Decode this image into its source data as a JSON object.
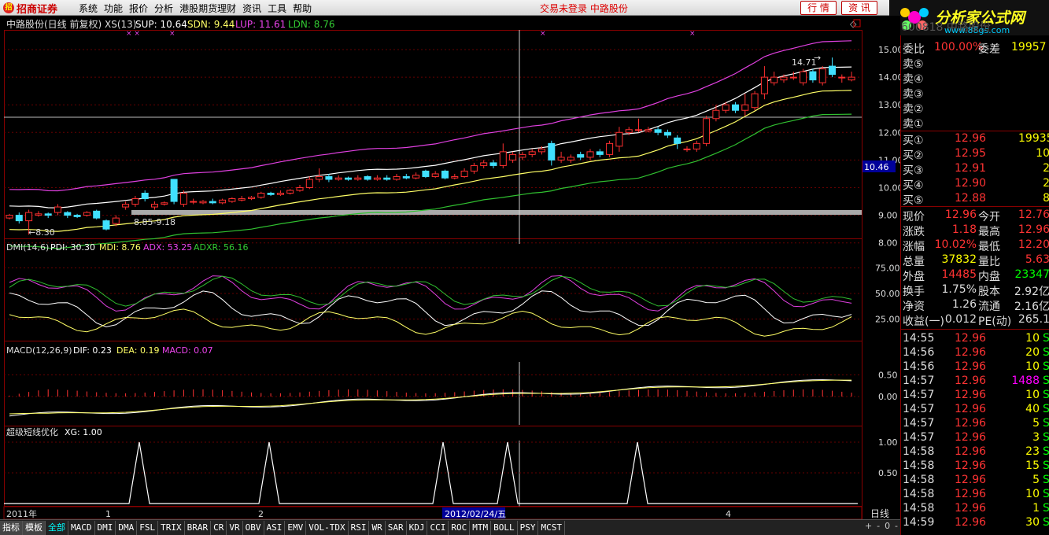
{
  "menubar": {
    "logo": "招商证券",
    "menus": [
      "系统",
      "功能",
      "报价",
      "分析",
      "港股期货理财",
      "资讯",
      "工具",
      "帮助"
    ],
    "login_status": "交易未登录 中路股份",
    "btn_quote": "行 情",
    "btn_news": "资 讯",
    "brand": "分析家公式网",
    "brand_url": "www.88gs.com"
  },
  "main_chart": {
    "title": "中路股份(日线 前复权) XS(13)",
    "sup_label": "SUP: 10.64",
    "sdn_label": "SDN: 9.44",
    "lup_label": "LUP: 11.61",
    "ldn_label": "LDN: 8.76",
    "price_ticks": [
      "15.00",
      "14.00",
      "13.00",
      "12.00",
      "11.00",
      "10.00",
      "9.00",
      "8.00"
    ],
    "current_price_tag": "10.46",
    "annot_low": "←8.30",
    "annot_range": "8.85-9.18",
    "annot_high": "14.71",
    "colors": {
      "up": "#ff3030",
      "down": "#40e0ff",
      "sup": "#ffffff",
      "sdn": "#ffff66",
      "lup": "#e040e0",
      "ldn": "#30c030"
    }
  },
  "dmi_panel": {
    "title": "DMI(14,6)",
    "pdi": "PDI: 30.30",
    "mdi": "MDI: 8.76",
    "adx": "ADX: 53.25",
    "adxr": "ADXR: 56.16",
    "ticks": [
      "75.00",
      "50.00",
      "25.00"
    ]
  },
  "macd_panel": {
    "title": "MACD(12,26,9)",
    "dif": "DIF: 0.23",
    "dea": "DEA: 0.19",
    "macd": "MACD: 0.07",
    "ticks": [
      "0.50",
      "0.00"
    ]
  },
  "xg_panel": {
    "title": "超级短线优化",
    "xg": "XG: 1.00",
    "ticks": [
      "1.00",
      "0.50"
    ]
  },
  "time_axis": {
    "year": "2011年",
    "m1": "1",
    "m2": "2",
    "cursor_date": "2012/02/24/五",
    "m4": "4",
    "period": "日线"
  },
  "bottom_tabs": [
    "指标",
    "模板",
    "全部",
    "MACD",
    "DMI",
    "DMA",
    "FSL",
    "TRIX",
    "BRAR",
    "CR",
    "VR",
    "OBV",
    "ASI",
    "EMV",
    "VOL-TDX",
    "RSI",
    "WR",
    "SAR",
    "KDJ",
    "CCI",
    "ROC",
    "MTM",
    "BOLL",
    "PSY",
    "MCST"
  ],
  "quote_panel": {
    "code_header": "600818 中路股份",
    "webi": "委比",
    "webi_val": "100.00%",
    "wecha": "委差",
    "wecha_val": "19957",
    "sells": [
      {
        "label": "卖⑤",
        "price": "",
        "vol": ""
      },
      {
        "label": "卖④",
        "price": "",
        "vol": ""
      },
      {
        "label": "卖③",
        "price": "",
        "vol": ""
      },
      {
        "label": "卖②",
        "price": "",
        "vol": ""
      },
      {
        "label": "卖①",
        "price": "",
        "vol": ""
      }
    ],
    "buys": [
      {
        "label": "买①",
        "price": "12.96",
        "vol": "19935"
      },
      {
        "label": "买②",
        "price": "12.95",
        "vol": "10"
      },
      {
        "label": "买③",
        "price": "12.91",
        "vol": "2"
      },
      {
        "label": "买④",
        "price": "12.90",
        "vol": "2"
      },
      {
        "label": "买⑤",
        "price": "12.88",
        "vol": "8"
      }
    ],
    "stats": [
      {
        "k1": "现价",
        "v1": "12.96",
        "k2": "今开",
        "v2": "12.76"
      },
      {
        "k1": "涨跌",
        "v1": "1.18",
        "k2": "最高",
        "v2": "12.96"
      },
      {
        "k1": "涨幅",
        "v1": "10.02%",
        "k2": "最低",
        "v2": "12.20"
      },
      {
        "k1": "总量",
        "v1": "37832",
        "k2": "量比",
        "v2": "5.63"
      },
      {
        "k1": "外盘",
        "v1": "14485",
        "k2": "内盘",
        "v2": "23347"
      },
      {
        "k1": "换手",
        "v1": "1.75%",
        "k2": "股本",
        "v2": "2.92亿"
      },
      {
        "k1": "净资",
        "v1": "1.26",
        "k2": "流通",
        "v2": "2.16亿"
      },
      {
        "k1": "收益(一)",
        "v1": "0.012",
        "k2": "PE(动)",
        "v2": "265.1"
      }
    ],
    "ticks": [
      {
        "t": "14:55",
        "p": "12.96",
        "v": "10",
        "f": "S"
      },
      {
        "t": "14:56",
        "p": "12.96",
        "v": "20",
        "f": "S"
      },
      {
        "t": "14:56",
        "p": "12.96",
        "v": "10",
        "f": "S"
      },
      {
        "t": "14:57",
        "p": "12.96",
        "v": "1488",
        "f": "S"
      },
      {
        "t": "14:57",
        "p": "12.96",
        "v": "10",
        "f": "S"
      },
      {
        "t": "14:57",
        "p": "12.96",
        "v": "40",
        "f": "S"
      },
      {
        "t": "14:57",
        "p": "12.96",
        "v": "5",
        "f": "S"
      },
      {
        "t": "14:57",
        "p": "12.96",
        "v": "3",
        "f": "S"
      },
      {
        "t": "14:58",
        "p": "12.96",
        "v": "23",
        "f": "S"
      },
      {
        "t": "14:58",
        "p": "12.96",
        "v": "15",
        "f": "S"
      },
      {
        "t": "14:58",
        "p": "12.96",
        "v": "5",
        "f": "S"
      },
      {
        "t": "14:58",
        "p": "12.96",
        "v": "10",
        "f": "S"
      },
      {
        "t": "14:58",
        "p": "12.96",
        "v": "1",
        "f": "S"
      },
      {
        "t": "14:59",
        "p": "12.96",
        "v": "30",
        "f": "S"
      }
    ]
  },
  "chart_data": {
    "type": "candlestick",
    "candles": [
      [
        8.9,
        9.0,
        8.85,
        9.05
      ],
      [
        9.0,
        8.8,
        8.7,
        9.1
      ],
      [
        8.8,
        9.1,
        8.3,
        9.2
      ],
      [
        9.0,
        9.05,
        8.95,
        9.15
      ],
      [
        9.05,
        9.0,
        8.9,
        9.1
      ],
      [
        9.1,
        9.3,
        9.0,
        9.4
      ],
      [
        9.1,
        9.0,
        8.9,
        9.15
      ],
      [
        9.0,
        8.95,
        8.9,
        9.05
      ],
      [
        9.0,
        9.1,
        8.95,
        9.15
      ],
      [
        9.15,
        8.9,
        8.85,
        9.2
      ],
      [
        8.8,
        8.5,
        8.45,
        8.85
      ],
      [
        8.7,
        8.9,
        8.6,
        9.0
      ],
      [
        9.3,
        9.4,
        9.2,
        9.5
      ],
      [
        9.4,
        9.6,
        9.3,
        9.7
      ],
      [
        9.8,
        9.6,
        9.5,
        9.9
      ],
      [
        9.3,
        9.4,
        9.2,
        9.5
      ],
      [
        9.4,
        9.45,
        9.35,
        9.5
      ],
      [
        10.3,
        9.5,
        9.4,
        10.3
      ],
      [
        9.4,
        9.8,
        9.3,
        9.9
      ],
      [
        9.5,
        9.5,
        9.4,
        9.6
      ],
      [
        9.45,
        9.5,
        9.4,
        9.55
      ],
      [
        9.5,
        9.45,
        9.4,
        9.6
      ],
      [
        9.45,
        9.55,
        9.4,
        9.6
      ],
      [
        9.5,
        9.6,
        9.45,
        9.65
      ],
      [
        9.55,
        9.6,
        9.5,
        9.7
      ],
      [
        9.6,
        9.65,
        9.55,
        9.7
      ],
      [
        9.65,
        9.8,
        9.6,
        9.85
      ],
      [
        9.8,
        9.75,
        9.7,
        9.85
      ],
      [
        9.75,
        9.8,
        9.7,
        9.9
      ],
      [
        9.8,
        9.9,
        9.75,
        9.95
      ],
      [
        9.9,
        10.0,
        9.85,
        10.1
      ],
      [
        10.0,
        10.3,
        9.95,
        10.4
      ],
      [
        10.3,
        10.4,
        10.2,
        10.7
      ],
      [
        10.4,
        10.3,
        10.2,
        10.5
      ],
      [
        10.3,
        10.35,
        10.25,
        10.45
      ],
      [
        10.35,
        10.3,
        10.25,
        10.4
      ],
      [
        10.3,
        10.35,
        10.25,
        10.45
      ],
      [
        10.4,
        10.3,
        10.25,
        10.45
      ],
      [
        10.3,
        10.35,
        10.25,
        10.45
      ],
      [
        10.35,
        10.3,
        10.25,
        10.45
      ],
      [
        10.3,
        10.4,
        10.25,
        10.5
      ],
      [
        10.4,
        10.35,
        10.3,
        10.5
      ],
      [
        10.35,
        10.45,
        10.3,
        10.55
      ],
      [
        10.6,
        10.4,
        10.35,
        10.65
      ],
      [
        10.4,
        10.5,
        10.35,
        10.6
      ],
      [
        10.6,
        10.35,
        10.3,
        10.65
      ],
      [
        10.35,
        10.4,
        10.3,
        10.5
      ],
      [
        10.4,
        10.6,
        10.35,
        10.7
      ],
      [
        10.6,
        10.8,
        10.5,
        10.9
      ],
      [
        10.8,
        10.9,
        10.7,
        11.0
      ],
      [
        10.9,
        10.8,
        10.7,
        11.0
      ],
      [
        10.8,
        11.3,
        10.7,
        11.6
      ],
      [
        11.0,
        11.2,
        10.9,
        11.3
      ],
      [
        11.1,
        11.2,
        11.0,
        11.3
      ],
      [
        11.2,
        11.3,
        11.1,
        11.4
      ],
      [
        11.3,
        11.4,
        11.2,
        11.5
      ],
      [
        11.6,
        11.0,
        10.8,
        11.7
      ],
      [
        11.0,
        11.1,
        10.9,
        11.3
      ],
      [
        11.0,
        11.1,
        10.9,
        11.2
      ],
      [
        11.2,
        11.1,
        11.0,
        11.3
      ],
      [
        11.1,
        11.3,
        11.0,
        11.4
      ],
      [
        11.3,
        11.2,
        11.1,
        11.4
      ],
      [
        11.2,
        11.6,
        11.1,
        11.7
      ],
      [
        11.5,
        12.0,
        11.3,
        12.2
      ],
      [
        12.0,
        12.1,
        11.9,
        12.2
      ],
      [
        12.1,
        12.1,
        12.0,
        12.5
      ],
      [
        12.05,
        12.1,
        12.0,
        12.2
      ],
      [
        12.1,
        12.0,
        11.9,
        12.2
      ],
      [
        12.0,
        11.9,
        11.8,
        12.1
      ],
      [
        11.8,
        11.6,
        11.4,
        11.9
      ],
      [
        11.4,
        11.4,
        11.3,
        11.5
      ],
      [
        11.4,
        11.6,
        11.3,
        11.7
      ],
      [
        11.6,
        12.5,
        11.5,
        12.6
      ],
      [
        12.5,
        12.8,
        12.4,
        13.0
      ],
      [
        12.8,
        13.0,
        12.7,
        13.1
      ],
      [
        13.0,
        12.8,
        12.7,
        13.1
      ],
      [
        12.8,
        13.0,
        12.6,
        13.4
      ],
      [
        12.9,
        13.4,
        12.8,
        13.5
      ],
      [
        13.4,
        14.0,
        13.2,
        14.4
      ],
      [
        13.8,
        14.0,
        13.7,
        14.2
      ],
      [
        13.9,
        14.0,
        13.8,
        14.1
      ],
      [
        14.0,
        14.0,
        13.9,
        14.2
      ],
      [
        13.8,
        14.2,
        13.7,
        14.3
      ],
      [
        14.2,
        13.9,
        13.8,
        14.3
      ],
      [
        13.8,
        14.3,
        13.7,
        14.4
      ],
      [
        14.4,
        14.1,
        14.0,
        14.71
      ],
      [
        14.0,
        14.0,
        13.8,
        14.1
      ],
      [
        13.9,
        14.0,
        13.85,
        14.2
      ]
    ]
  }
}
